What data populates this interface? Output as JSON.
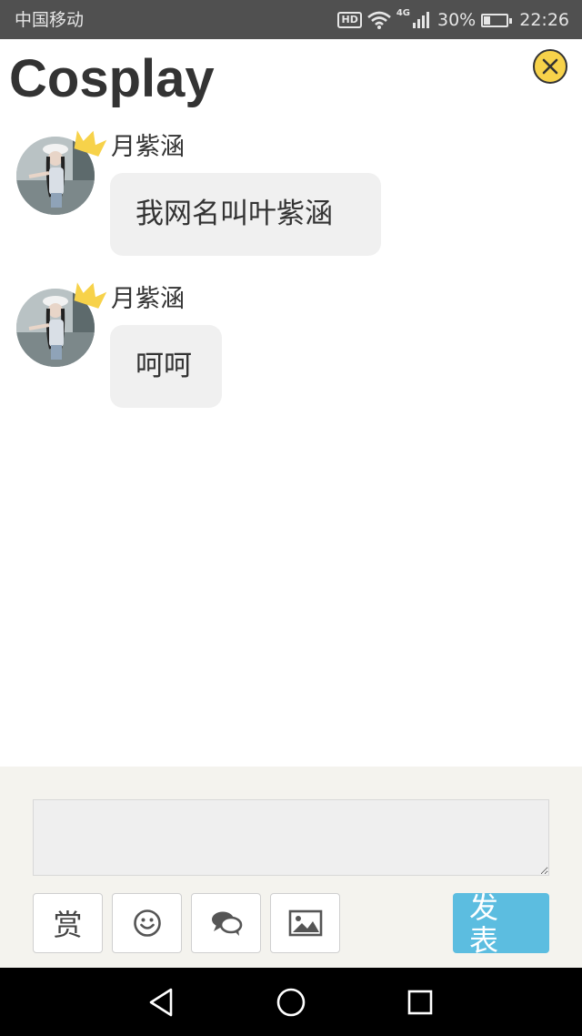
{
  "status_bar": {
    "carrier": "中国移动",
    "hd": "HD",
    "network": "4G",
    "battery_percent_text": "30%",
    "battery_level": 0.3,
    "time": "22:26"
  },
  "header": {
    "title": "Cosplay",
    "close_icon": "close-icon"
  },
  "messages": [
    {
      "sender": "月紫涵",
      "text": "我网名叫叶紫涵"
    },
    {
      "sender": "月紫涵",
      "text": "呵呵"
    }
  ],
  "composer": {
    "input_value": "",
    "reward_label": "赏",
    "icons": [
      "smiley-icon",
      "comment-icon",
      "image-icon"
    ],
    "send_label": "发表",
    "send_color": "#5cbde0"
  },
  "colors": {
    "accent": "#f7d24a",
    "bubble": "#f0f0f0",
    "panel": "#f4f3ee"
  }
}
